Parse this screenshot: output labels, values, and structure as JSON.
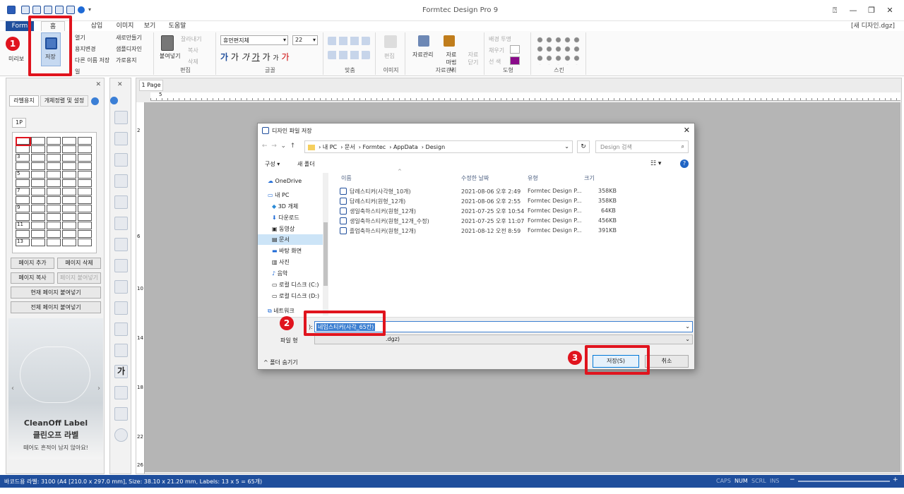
{
  "app": {
    "title": "Formtec Design Pro 9",
    "doc_name": "[새 디자인.dgz]"
  },
  "tabs": [
    "Form",
    "홈",
    "",
    "삽입",
    "이미지",
    "보기",
    "도움말"
  ],
  "ribbon": {
    "file": {
      "save": "저장",
      "preview": "미리보",
      "open": "열기",
      "change_paper": "용지변경",
      "save_as": "다른 이름 저장",
      "new": "새로만들기",
      "sample": "샘플디자인",
      "landscape": "가로용지",
      "label": "일"
    },
    "edit": {
      "paste": "붙여넣기",
      "cut": "잘라내기",
      "copy": "복사",
      "delete": "삭제",
      "label": "편집"
    },
    "font": {
      "name": "휴먼편지체",
      "size": "22",
      "label": "글꼴",
      "glyphs": [
        "가",
        "가",
        "가",
        "가",
        "가",
        "가",
        "가",
        "가"
      ]
    },
    "align": {
      "label": "맞춤"
    },
    "image": {
      "edit": "편집",
      "label": "이미지"
    },
    "data": {
      "manage": "자료관리",
      "wizard": "자료마법사",
      "close": "자료닫기",
      "label": "자료관리"
    },
    "shape": {
      "bg_transparent": "배경 투명",
      "fill": "채우기",
      "line": "선 색",
      "label": "도형",
      "line_color": "#8a0a8a"
    },
    "skin": {
      "label": "스킨"
    }
  },
  "left": {
    "tabs": [
      "라벨용지",
      "개체정렬 및 설정"
    ],
    "page_tab": "1P",
    "row_labels": [
      "3",
      "5",
      "7",
      "9",
      "11",
      "13"
    ],
    "buttons": [
      "페이지 추가",
      "페이지 삭제",
      "페이지 복사",
      "페이지 붙여넣기",
      "현재 페이지 붙여넣기",
      "전체 페이지 붙여넣기"
    ],
    "ad": {
      "brand": "CleanOff Label",
      "ko": "클린오프 라벨",
      "sub": "떼어도 흔적이 남지 않아요!"
    }
  },
  "doc": {
    "tab": "1 Page",
    "ruler_top": [
      "5"
    ],
    "ruler_left": [
      "2",
      "6",
      "10",
      "14",
      "18",
      "22",
      "26"
    ]
  },
  "dialog": {
    "title": "디자인 파일 저장",
    "crumbs": [
      "내 PC",
      "문서",
      "Formtec",
      "AppData",
      "Design"
    ],
    "search": "Design 검색",
    "organize": "구성",
    "new_folder": "새 폴더",
    "nav": [
      "OneDrive",
      "내 PC",
      "3D 개체",
      "다운로드",
      "동영상",
      "문서",
      "바탕 화면",
      "사진",
      "음악",
      "로컬 디스크 (C:)",
      "로컬 디스크 (D:)",
      "네트워크"
    ],
    "cols": [
      "이름",
      "수정한 날짜",
      "유형",
      "크기"
    ],
    "files": [
      {
        "name": "답례스티커(사각형_10개)",
        "date": "2021-08-06 오후 2:49",
        "type": "Formtec Design P...",
        "size": "358KB"
      },
      {
        "name": "답례스티커(원형_12개)",
        "date": "2021-08-06 오후 2:55",
        "type": "Formtec Design P...",
        "size": "358KB"
      },
      {
        "name": "생일축하스티커(원형_12개)",
        "date": "2021-07-25 오후 10:54",
        "type": "Formtec Design P...",
        "size": "64KB"
      },
      {
        "name": "생일축하스티커(원형_12개_수정)",
        "date": "2021-07-25 오후 11:07",
        "type": "Formtec Design P...",
        "size": "456KB"
      },
      {
        "name": "졸업축하스티커(원형_12개)",
        "date": "2021-08-12 오전 8:59",
        "type": "Formtec Design P...",
        "size": "391KB"
      }
    ],
    "filename_label": "):",
    "filename_value": "네임스티커(사각_65칸)",
    "filetype_label": "파일 형",
    "filetype_value": ".dgz)",
    "hide_folders": "폴더 숨기기",
    "save_btn": "저장(S)",
    "cancel_btn": "취소"
  },
  "badges": [
    "1",
    "2",
    "3"
  ],
  "status": {
    "text": "바코드용 라벨: 3100 (A4 [210.0 x 297.0 mm], Size: 38.10 x 21.20 mm, Labels: 13 x 5 = 65개)",
    "caps": "CAPS",
    "num": "NUM",
    "scrl": "SCRL",
    "ins": "INS"
  },
  "colors": {
    "accent": "#1f4e9c",
    "highlight": "#e0141e"
  }
}
